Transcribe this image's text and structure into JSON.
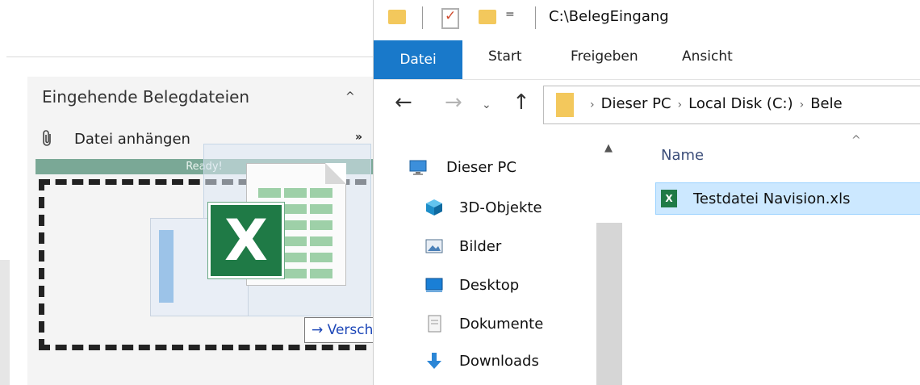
{
  "left_panel": {
    "title": "Eingehende Belegdateien",
    "collapse_icon": "^",
    "attach_label": "Datei anhängen",
    "more_icon": "»",
    "ready_text": "Ready!",
    "drag_tooltip": "→ Verschieben"
  },
  "explorer": {
    "path_title": "C:\\BelegEingang",
    "qat_dropdown": "=",
    "ribbon_tabs": [
      {
        "label": "Datei",
        "active": true
      },
      {
        "label": "Start"
      },
      {
        "label": "Freigeben"
      },
      {
        "label": "Ansicht"
      }
    ],
    "nav": {
      "back": "←",
      "forward": "→",
      "recent": "⌄",
      "up": "↑"
    },
    "address_parts": [
      "Dieser PC",
      "Local Disk (C:)",
      "Bele"
    ],
    "address_separator": "›",
    "nav_pane": [
      {
        "label": "Dieser PC",
        "icon": "monitor-icon"
      },
      {
        "label": "3D-Objekte",
        "icon": "cube-icon"
      },
      {
        "label": "Bilder",
        "icon": "pictures-icon"
      },
      {
        "label": "Desktop",
        "icon": "desktop-icon"
      },
      {
        "label": "Dokumente",
        "icon": "documents-icon"
      },
      {
        "label": "Downloads",
        "icon": "download-icon"
      }
    ],
    "column_header": "Name",
    "files": [
      {
        "name": "Testdatei Navision.xls",
        "icon": "excel-file-icon",
        "selected": true
      }
    ]
  },
  "colors": {
    "ribbon_file_tab": "#1979ca",
    "ready_bar": "#7aa896",
    "selection": "#cce8ff",
    "excel_green": "#1f7a46",
    "folder_yellow": "#f3c85c"
  }
}
